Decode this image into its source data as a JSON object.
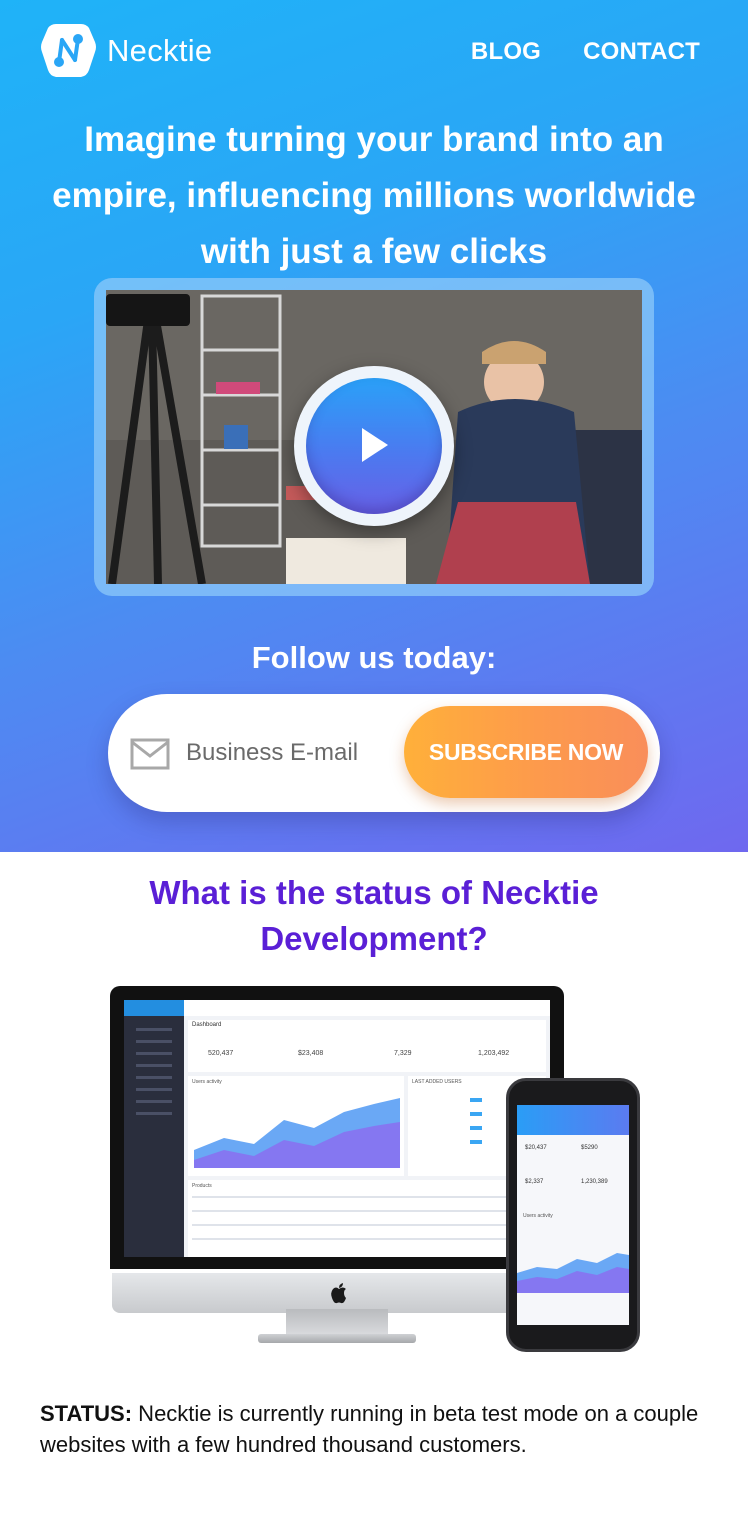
{
  "brand": {
    "name": "Necktie"
  },
  "nav": {
    "items": [
      "BLOG",
      "CONTACT"
    ]
  },
  "hero": {
    "headline": "Imagine turning your brand into an empire, influencing millions worldwide with just a few clicks",
    "follow_label": "Follow us today:",
    "email_placeholder": "Business E-mail",
    "subscribe_label": "SUBSCRIBE NOW"
  },
  "status_section": {
    "title": "What is the status of Necktie Development?",
    "status_label": "STATUS:",
    "status_text": " Necktie is currently running in beta test mode on a couple websites with a few hundred thousand customers."
  },
  "mockup": {
    "dashboard_title": "Dashboard",
    "stats": [
      "520,437",
      "$23,408",
      "7,329",
      "1,203,492"
    ],
    "panel_users_activity": "Users activity",
    "panel_last_users": "LAST ADDED USERS",
    "panel_products": "Products",
    "phone_stats": [
      "$20,437",
      "$5290",
      "$2,337",
      "1,230,389"
    ]
  },
  "colors": {
    "accent_purple": "#5a1fd6",
    "subscribe_orange": "#fd9a4c",
    "hero_blue": "#2aa6f6",
    "hero_violet": "#6f68ef"
  }
}
